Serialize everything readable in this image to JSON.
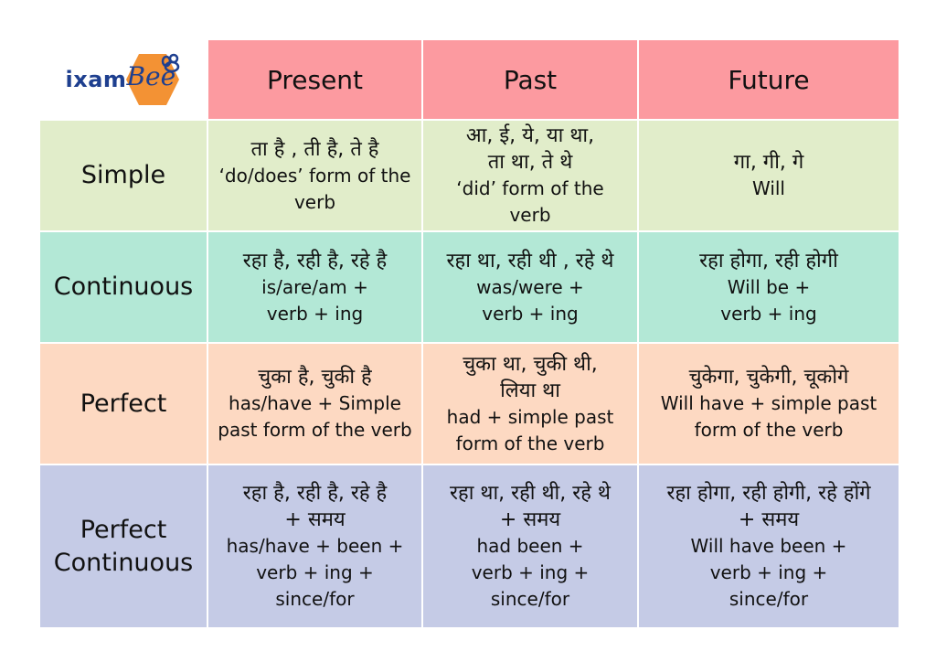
{
  "logo": {
    "part1": "ixam",
    "part2": "Bee",
    "brand_blue": "#1e3f8f",
    "brand_orange": "#f39234"
  },
  "columns": [
    "Present",
    "Past",
    "Future"
  ],
  "colors": {
    "header": "#fc9aa0",
    "simple": "#e1edca",
    "continuous": "#b3e8d6",
    "perfect": "#fdd9c2",
    "perfect_continuous": "#c5cbe6"
  },
  "rows": [
    {
      "label": [
        "Simple"
      ],
      "cells": [
        {
          "hindi": [
            "ता है , ती है, ते है"
          ],
          "english": [
            "‘do/does’ form of the",
            "verb"
          ]
        },
        {
          "hindi": [
            "आ, ई, ये, या था,",
            "ता था, ते थे"
          ],
          "english": [
            "‘did’ form of the",
            "verb"
          ]
        },
        {
          "hindi": [
            "गा, गी, गे"
          ],
          "english": [
            "Will"
          ]
        }
      ]
    },
    {
      "label": [
        "Continuous"
      ],
      "cells": [
        {
          "hindi": [
            "रहा है, रही है, रहे है"
          ],
          "english": [
            "is/are/am +",
            "verb + ing"
          ]
        },
        {
          "hindi": [
            "रहा था, रही थी , रहे थे"
          ],
          "english": [
            "was/were +",
            "verb + ing"
          ]
        },
        {
          "hindi": [
            "रहा होगा, रही होगी"
          ],
          "english": [
            "Will be +",
            "verb + ing"
          ]
        }
      ]
    },
    {
      "label": [
        "Perfect"
      ],
      "cells": [
        {
          "hindi": [
            "चुका है, चुकी है"
          ],
          "english": [
            "has/have + Simple",
            "past form of the verb"
          ]
        },
        {
          "hindi": [
            "चुका था, चुकी थी,",
            "लिया था"
          ],
          "english": [
            "had + simple past",
            "form of the verb"
          ]
        },
        {
          "hindi": [
            "चुकेगा, चुकेगी, चूकोगे"
          ],
          "english": [
            "Will have + simple past",
            "form of the verb"
          ]
        }
      ]
    },
    {
      "label": [
        "Perfect",
        "Continuous"
      ],
      "cells": [
        {
          "hindi": [
            "रहा है, रही है, रहे है",
            "+ समय"
          ],
          "english": [
            "has/have + been +",
            "verb + ing +",
            "since/for"
          ]
        },
        {
          "hindi": [
            "रहा था, रही थी, रहे थे",
            "+ समय"
          ],
          "english": [
            "had been  +",
            "verb + ing +",
            "since/for"
          ]
        },
        {
          "hindi": [
            "रहा होगा, रही होगी, रहे होंगे",
            "+ समय"
          ],
          "english": [
            "Will have been +",
            "verb + ing +",
            "since/for"
          ]
        }
      ]
    }
  ]
}
